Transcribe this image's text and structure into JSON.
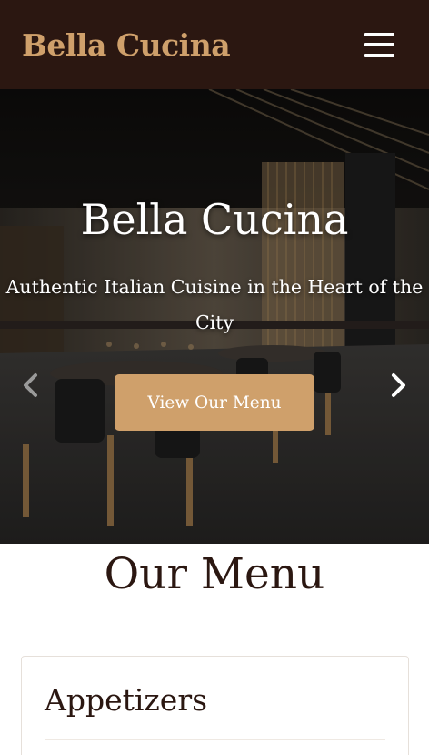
{
  "navbar": {
    "brand": "Bella Cucina",
    "menu_icon": "hamburger-icon"
  },
  "hero": {
    "title": "Bella Cucina",
    "subtitle": "Authentic Italian Cuisine in the Heart of the City",
    "button_label": "View Our Menu",
    "prev_icon": "chevron-left-icon",
    "next_icon": "chevron-right-icon",
    "image": "restaurant-interior-photo"
  },
  "menu_section": {
    "title": "Our Menu",
    "categories": [
      {
        "name": "Appetizers"
      }
    ]
  },
  "colors": {
    "nav_bg": "#2b1711",
    "accent": "#cfa06b",
    "heading": "#2b1711"
  }
}
